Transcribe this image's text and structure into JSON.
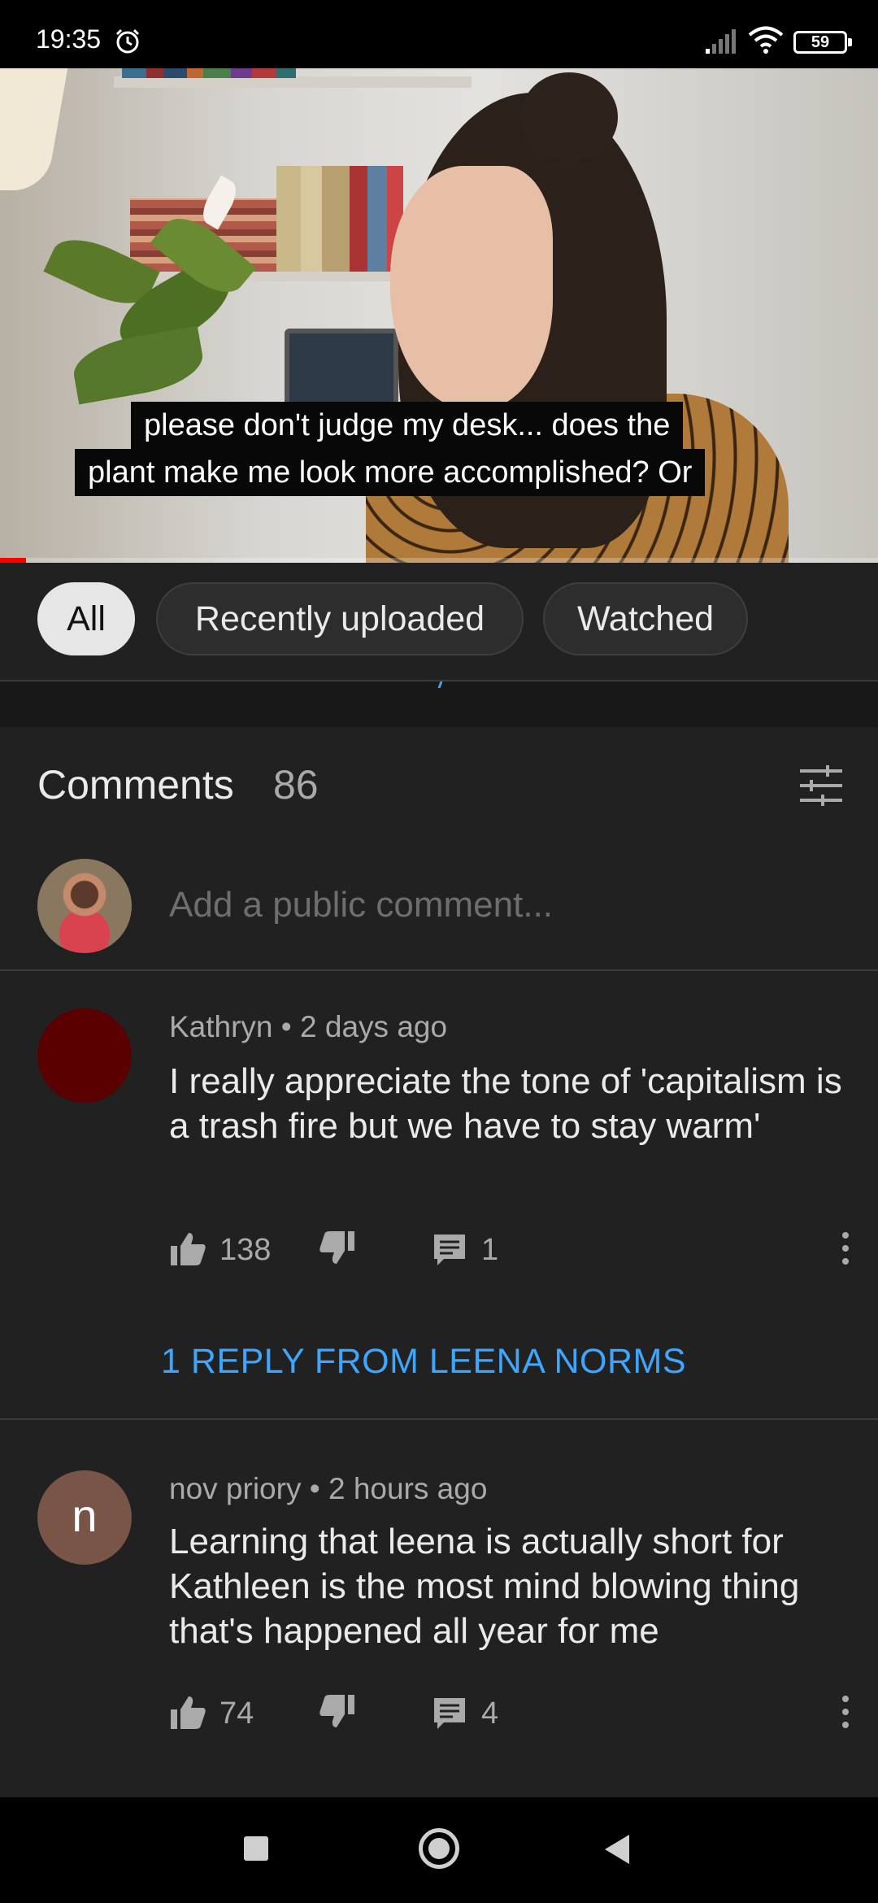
{
  "status_bar": {
    "time": "19:35",
    "battery": "59"
  },
  "video": {
    "caption_line1": "please don't judge my desk... does the",
    "caption_line2": "plant make me look more accomplished? Or",
    "progress": 0.03
  },
  "chips": [
    {
      "label": "All",
      "active": true
    },
    {
      "label": "Recently uploaded",
      "active": false
    },
    {
      "label": "Watched",
      "active": false
    }
  ],
  "comments": {
    "title": "Comments",
    "count": "86",
    "add_placeholder": "Add a public comment...",
    "items": [
      {
        "author": "Kathryn",
        "time": "2 days ago",
        "text": "I really appreciate the tone of 'capitalism is a trash fire but we have to stay warm'",
        "likes": "138",
        "replies": "1",
        "avatar_color": "#5a0000",
        "avatar_letter": "",
        "reply_link": "1 REPLY FROM LEENA NORMS"
      },
      {
        "author": "nov priory",
        "time": "2 hours ago",
        "text": "Learning that leena is actually short for Kathleen is the most mind blowing thing that's happened all year for me",
        "likes": "74",
        "replies": "4",
        "avatar_color": "#795548",
        "avatar_letter": "n"
      }
    ]
  },
  "colors": {
    "accent_link": "#3ea6ff",
    "background": "#212121"
  }
}
